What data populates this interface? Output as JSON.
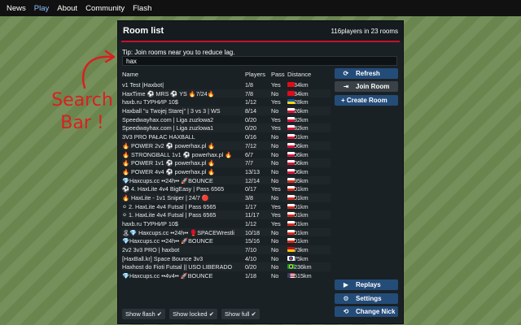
{
  "nav": [
    "News",
    "Play",
    "About",
    "Community",
    "Flash"
  ],
  "annotation": {
    "line1": "Search",
    "line2": "Bar !"
  },
  "room_list": {
    "title": "Room list",
    "count": "116players in 23 rooms",
    "tip": "Tip: Join rooms near you to reduce lag.",
    "search_value": "hax",
    "columns": {
      "name": "Name",
      "players": "Players",
      "pass": "Pass",
      "distance": "Distance"
    },
    "rows": [
      {
        "name": "v1 Test |Haxbot|",
        "players": "1/8",
        "pass": "Yes",
        "flag": "tr",
        "distance": "1234km"
      },
      {
        "name": "HaxTime ⚽ MRS ⚽ YS 🔥7/24🔥",
        "players": "7/8",
        "pass": "No",
        "flag": "tr",
        "distance": "1234km"
      },
      {
        "name": "haxb.ru ТУРНИР 10$",
        "players": "1/12",
        "pass": "Yes",
        "flag": "ua",
        "distance": "2028km"
      },
      {
        "name": "Haxball \"u Twojej Starej\" | 3 vs 3 | WS",
        "players": "8/14",
        "pass": "No",
        "flag": "pl",
        "distance": "2426km"
      },
      {
        "name": "Speedwayhax.com | Liga zuzlowa2",
        "players": "0/20",
        "pass": "Yes",
        "flag": "pl",
        "distance": "2582km"
      },
      {
        "name": "Speedwayhax.com | Liga zuzlowa1",
        "players": "0/20",
        "pass": "Yes",
        "flag": "pl",
        "distance": "2582km"
      },
      {
        "name": "3V3 PRO PAŁAC HAXBALL",
        "players": "0/16",
        "pass": "No",
        "flag": "pl",
        "distance": "2601km"
      },
      {
        "name": "🔥 POWER 2v2 ⚽ powerhax.pl 🔥",
        "players": "7/12",
        "pass": "No",
        "flag": "pl",
        "distance": "2606km"
      },
      {
        "name": "🔥 STRONGBALL 1v1 ⚽ powerhax.pl 🔥",
        "players": "6/7",
        "pass": "No",
        "flag": "pl",
        "distance": "2606km"
      },
      {
        "name": "🔥 POWER 1v1 ⚽ powerhax.pl 🔥",
        "players": "7/7",
        "pass": "No",
        "flag": "pl",
        "distance": "2606km"
      },
      {
        "name": "🔥 POWER 4v4 ⚽ powerhax.pl 🔥",
        "players": "13/13",
        "pass": "No",
        "flag": "pl",
        "distance": "2606km"
      },
      {
        "name": "💎Haxcups.cc ••24h•• 🚀BOUNCE",
        "players": "12/14",
        "pass": "No",
        "flag": "ru",
        "distance": "2895km"
      },
      {
        "name": "⚽ 4. HaxLite 4v4 BigEasy | Pass 6565",
        "players": "0/17",
        "pass": "Yes",
        "flag": "ru",
        "distance": "2901km"
      },
      {
        "name": "🔥 HaxLite - 1v1 Sniper | 24/7 🔴",
        "players": "3/8",
        "pass": "No",
        "flag": "ru",
        "distance": "2901km"
      },
      {
        "name": "⚪ 2. HaxLite 4v4 Futsal | Pass 6565",
        "players": "1/17",
        "pass": "Yes",
        "flag": "ru",
        "distance": "2901km"
      },
      {
        "name": "⚪ 1. HaxLite 4v4 Futsal | Pass 6565",
        "players": "11/17",
        "pass": "Yes",
        "flag": "ru",
        "distance": "2901km"
      },
      {
        "name": "haxb.ru ТУРНИР 10$",
        "players": "1/12",
        "pass": "Yes",
        "flag": "ru",
        "distance": "2901km"
      },
      {
        "name": "🏝💎 Haxcups.cc ••24h•• 🥊SPACEWrestli",
        "players": "10/18",
        "pass": "No",
        "flag": "ru",
        "distance": "2901km"
      },
      {
        "name": "💎Haxcups.cc ••24h•• 🚀BOUNCE",
        "players": "15/16",
        "pass": "No",
        "flag": "ru",
        "distance": "2901km"
      },
      {
        "name": "2v2 3v3 PRO | haxbot",
        "players": "7/10",
        "pass": "No",
        "flag": "es",
        "distance": "3273km"
      },
      {
        "name": "[HaxBall.kr] Space Bounce 3v3",
        "players": "4/10",
        "pass": "No",
        "flag": "kr",
        "distance": "8475km"
      },
      {
        "name": "Haxhost do Fioti Futsal || USO LIBERADO",
        "players": "0/20",
        "pass": "No",
        "flag": "br",
        "distance": "10236km"
      },
      {
        "name": "💎Haxcups.cc ••4v4•• 🚀BOUNCE",
        "players": "1/18",
        "pass": "No",
        "flag": "us",
        "distance": "10515km"
      }
    ],
    "buttons": {
      "refresh": "Refresh",
      "join": "Join Room",
      "create": "+ Create Room",
      "replays": "Replays",
      "settings": "Settings",
      "change_nick": "Change Nick"
    },
    "toggles": [
      "Show flash",
      "Show locked",
      "Show full"
    ],
    "check": "✔"
  },
  "flags": {
    "tr": [
      "#e30a17",
      "#e30a17"
    ],
    "ua": [
      "#0057b7",
      "#ffd700"
    ],
    "pl": [
      "#ffffff",
      "#dc143c"
    ],
    "ru": [
      "#ffffff",
      "#d52b1e"
    ],
    "es": [
      "#c60b1e",
      "#ffc400"
    ],
    "kr": [
      "#ffffff",
      "#ffffff"
    ],
    "br": [
      "#009c3b",
      "#ffdf00"
    ],
    "us": [
      "#b22234",
      "#3c3b6e"
    ]
  }
}
